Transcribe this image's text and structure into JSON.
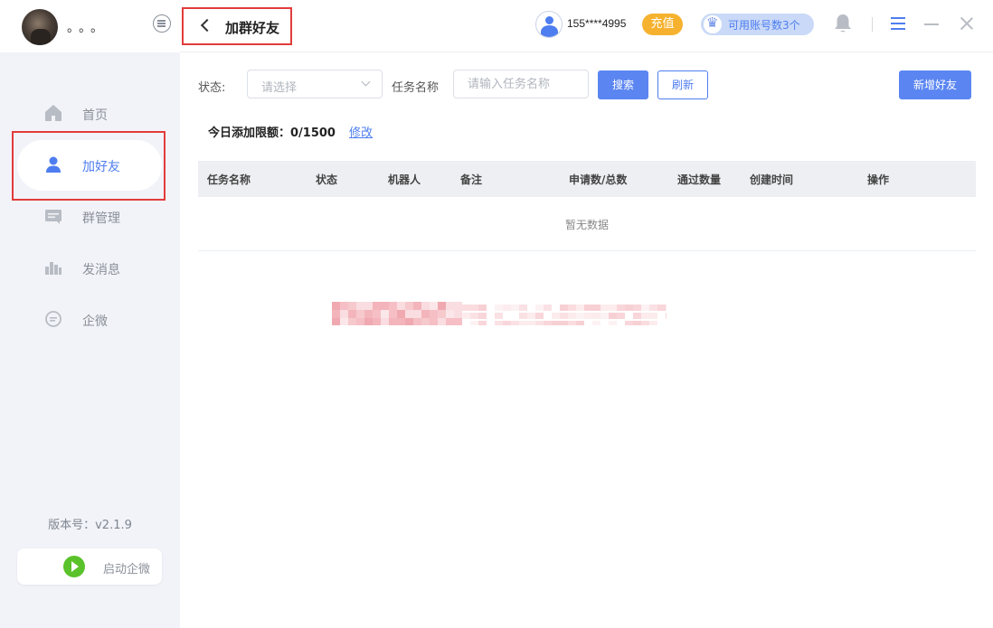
{
  "sidebar": {
    "user_name": "。。。",
    "items": [
      {
        "label": "首页",
        "icon": "home-icon"
      },
      {
        "label": "加好友",
        "icon": "user-icon"
      },
      {
        "label": "群管理",
        "icon": "group-chat-icon"
      },
      {
        "label": "发消息",
        "icon": "message-stats-icon"
      },
      {
        "label": "企微",
        "icon": "chat-bubble-icon"
      }
    ],
    "version": "版本号：v2.1.9",
    "start_button": "启动企微"
  },
  "header": {
    "title": "加群好友",
    "phone": "155****4995",
    "recharge": "充值",
    "accounts": "可用账号数3个"
  },
  "filters": {
    "status_label": "状态:",
    "status_placeholder": "请选择",
    "task_label": "任务名称",
    "task_placeholder": "请输入任务名称",
    "search": "搜索",
    "refresh": "刷新",
    "add_friend": "新增好友"
  },
  "limit": {
    "label": "今日添加限额：0/1500",
    "edit": "修改"
  },
  "table": {
    "columns": [
      "任务名称",
      "状态",
      "机器人",
      "备注",
      "申请数/总数",
      "通过数量",
      "创建时间",
      "操作"
    ],
    "empty_text": "暂无数据"
  },
  "colors": {
    "accent": "#4e7df0",
    "highlight_border": "#e23c3c",
    "recharge": "#f6b22f",
    "start_button": "#5ac22b"
  }
}
